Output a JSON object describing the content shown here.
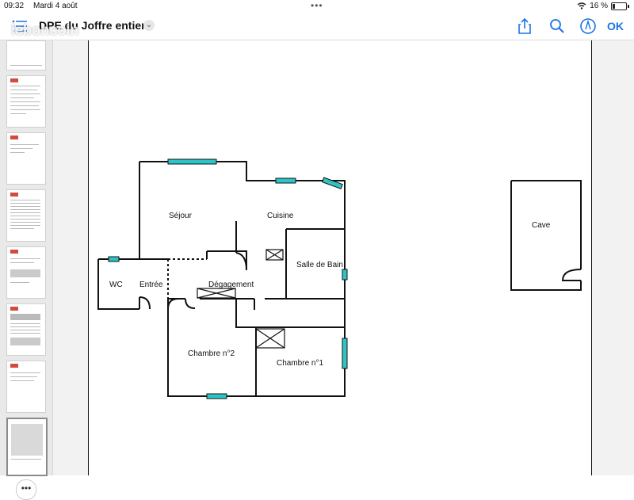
{
  "status": {
    "time": "09:32",
    "date": "Mardi 4 août",
    "battery": "16 %"
  },
  "toolbar": {
    "title": "DPE du Joffre entier",
    "watermark": "leboncoin",
    "ok_label": "OK"
  },
  "icons": [
    "list-icon",
    "chevron-down-icon",
    "share-icon",
    "search-icon",
    "markup-icon",
    "wifi-icon",
    "battery-icon",
    "more-icon"
  ],
  "sidebar": {
    "more_label": "•••",
    "thumbnail_count": 8,
    "selected_index": 7
  },
  "plan": {
    "rooms": {
      "sejour": "Séjour",
      "cuisine": "Cuisine",
      "salle_de_bain": "Salle de Bain",
      "wc": "WC",
      "entree": "Entrée",
      "degagement": "Dégagement",
      "chambre2": "Chambre n°2",
      "chambre1": "Chambre n°1",
      "cave": "Cave"
    },
    "window_color": "#2ec4c6",
    "wall_color": "#111111"
  }
}
